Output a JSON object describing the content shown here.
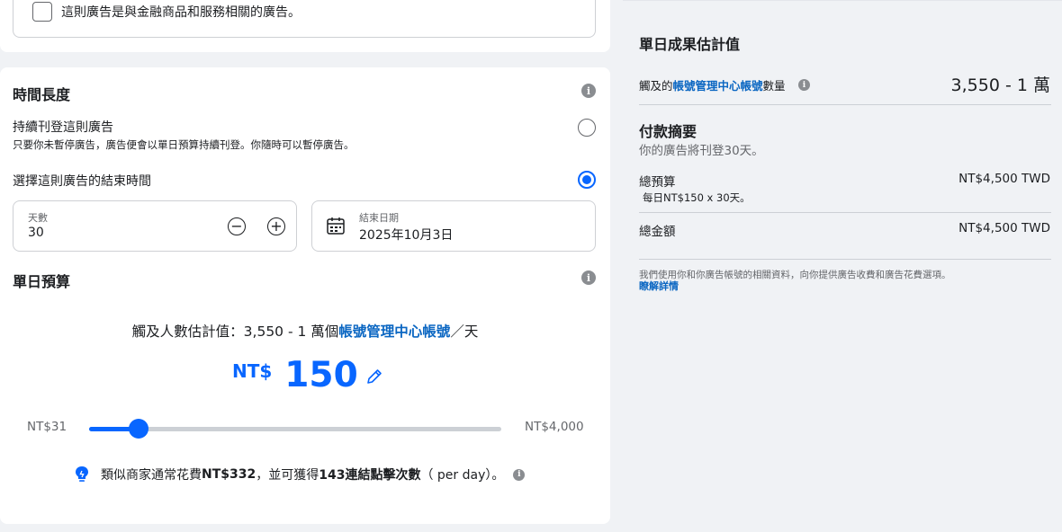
{
  "special_category": {
    "checkbox_label": "這則廣告是與金融商品和服務相關的廣告。",
    "checked": false
  },
  "duration": {
    "title": "時間長度",
    "continuous_title": "持續刊登這則廣告",
    "continuous_desc": "只要你未暫停廣告，廣告便會以單日預算持續刊登。你隨時可以暫停廣告。",
    "end_date_title": "選擇這則廣告的結束時間",
    "selected_option": "end_date",
    "days_label": "天數",
    "days_value": "30",
    "minus_symbol": "−",
    "plus_symbol": "+",
    "end_date_label": "結束日期",
    "end_date_value": "2025年10月3日",
    "info_icon": "info-icon"
  },
  "daily_budget": {
    "title": "單日預算",
    "reach_prefix": "觸及人數估計值：3,550 - 1 萬個",
    "reach_link": "帳號管理中心帳號",
    "reach_suffix": "／天",
    "currency": "NT$",
    "amount": "150",
    "slider_min": "NT$31",
    "slider_max": "NT$4,000",
    "slider_fraction": 0.121,
    "tip_part1": "類似商家通常花費",
    "tip_amount": "NT$332",
    "tip_part2": "，並可獲得",
    "tip_clicks": "143連結點擊次數",
    "tip_part3": "（ per day）。"
  },
  "estimate": {
    "title": "單日成果估計值",
    "reach_prefix": "觸及的",
    "reach_link": "帳號管理中心帳號",
    "reach_suffix": "數量",
    "reach_value": "3,550 - 1 萬"
  },
  "payment": {
    "title": "付款摘要",
    "subtitle": "你的廣告將刊登30天。",
    "total_budget_label": "總預算",
    "total_budget_value": "NT$4,500 TWD",
    "total_budget_detail": "每日NT$150 x 30天。",
    "total_amount_label": "總金額",
    "total_amount_value": "NT$4,500 TWD",
    "disclaimer": "我們使用你和你廣告帳號的相關資料，向你提供廣告收費和廣告花費選項。",
    "learn_more": "瞭解詳情"
  },
  "colors": {
    "accent": "#0866ff",
    "link": "#0a66c2",
    "background": "#f0f2f5"
  }
}
